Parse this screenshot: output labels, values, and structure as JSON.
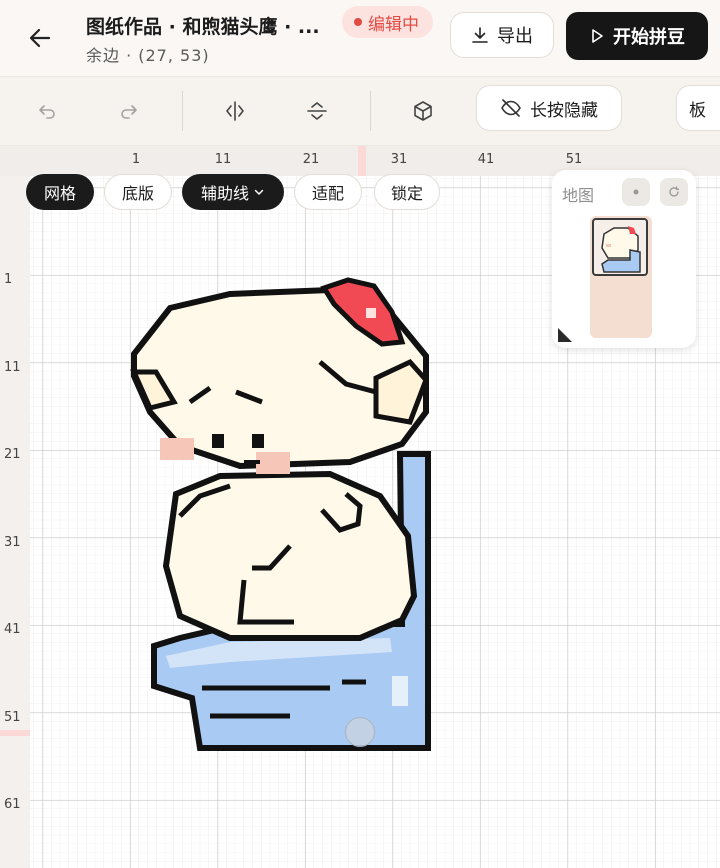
{
  "header": {
    "title": "图纸作品 · 和煦猫头鹰 · ...",
    "subtitle": "余边 · (27, 53)",
    "status": "编辑中",
    "export_label": "导出",
    "start_label": "开始拼豆"
  },
  "toolbar": {
    "hide_label": "长按隐藏",
    "board_label": "板"
  },
  "canvas": {
    "chips": {
      "grid": "网格",
      "base": "底版",
      "guides": "辅助线",
      "fit": "适配",
      "lock": "锁定"
    },
    "minimap_label": "地图",
    "ruler_x": [
      "1",
      "11",
      "21",
      "31",
      "41",
      "51"
    ],
    "ruler_y": [
      "1",
      "11",
      "21",
      "31",
      "41",
      "51",
      "61"
    ]
  },
  "colors": {
    "accent_red": "#e14b44",
    "outline": "#111111",
    "cream": "#fff9ea",
    "blue": "#9fc3ef",
    "blue_light": "#cfe1f8",
    "blush": "#f6c6b8",
    "red_bow": "#f0404a"
  }
}
